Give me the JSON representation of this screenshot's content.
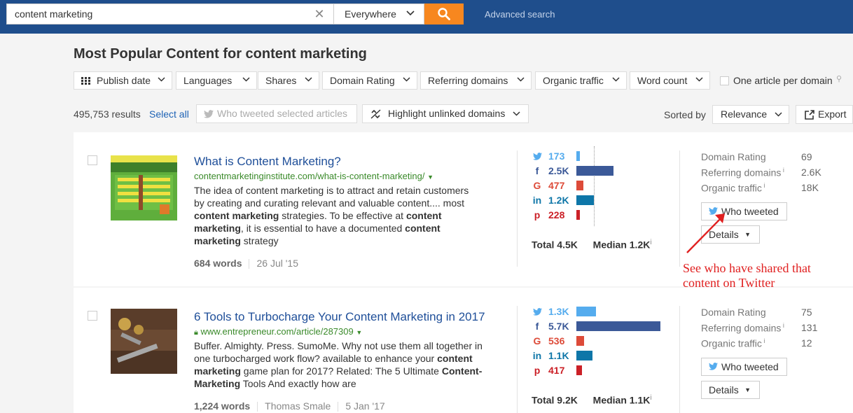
{
  "search": {
    "query": "content marketing",
    "scope": "Everywhere",
    "advanced_label": "Advanced search"
  },
  "page_title": "Most Popular Content for content marketing",
  "filters": [
    {
      "label": "Publish date"
    },
    {
      "label": "Languages"
    },
    {
      "label": "Shares"
    },
    {
      "label": "Domain Rating"
    },
    {
      "label": "Referring domains"
    },
    {
      "label": "Organic traffic"
    },
    {
      "label": "Word count"
    }
  ],
  "one_per_domain_label": "One article per domain",
  "toolbar": {
    "results_count": "495,753 results",
    "select_all": "Select all",
    "who_tweeted_selected": "Who tweeted selected articles",
    "highlight_unlinked": "Highlight unlinked domains",
    "sorted_by_label": "Sorted by",
    "sort_value": "Relevance",
    "export_label": "Export"
  },
  "results": [
    {
      "title": "What is Content Marketing?",
      "url": "contentmarketinginstitute.com/what-is-content-marketing/",
      "snippet": [
        {
          "t": "The idea of content marketing is to attract and retain customers by creating and curating relevant and valuable content.... most "
        },
        {
          "t": "content marketing",
          "b": true
        },
        {
          "t": " strategies. To be effective at "
        },
        {
          "t": "content marketing",
          "b": true
        },
        {
          "t": ", it is essential to have a documented "
        },
        {
          "t": "content marketing",
          "b": true
        },
        {
          "t": " strategy"
        }
      ],
      "words": "684 words",
      "author": "",
      "date": "26 Jul '15",
      "shares": [
        {
          "network": "twitter",
          "value": "173",
          "level": 0.04
        },
        {
          "network": "facebook",
          "value": "2.5K",
          "level": 0.44
        },
        {
          "network": "google",
          "value": "477",
          "level": 0.08
        },
        {
          "network": "linkedin",
          "value": "1.2K",
          "level": 0.21
        },
        {
          "network": "pinterest",
          "value": "228",
          "level": 0.04
        }
      ],
      "total": "Total 4.5K",
      "median": "Median 1.2K",
      "domain_rating": {
        "label": "Domain Rating",
        "value": "69"
      },
      "referring_domains": {
        "label": "Referring domains",
        "value": "2.6K"
      },
      "organic_traffic": {
        "label": "Organic traffic",
        "value": "18K"
      },
      "who_tweeted": "Who tweeted",
      "details": "Details"
    },
    {
      "title": "6 Tools to Turbocharge Your Content Marketing in 2017",
      "url": "www.entrepreneur.com/article/287309",
      "snippet": [
        {
          "t": "Buffer. Almighty. Press. SumoMe. Why not use them all together in one turbocharged work flow? available to enhance your "
        },
        {
          "t": "content marketing",
          "b": true
        },
        {
          "t": " game plan for 2017? Related:  The 5 Ultimate "
        },
        {
          "t": "Content-Marketing",
          "b": true
        },
        {
          "t": " Tools And exactly how are"
        }
      ],
      "words": "1,224 words",
      "author": "Thomas Smale",
      "date": "5 Jan '17",
      "shares": [
        {
          "network": "twitter",
          "value": "1.3K",
          "level": 0.23
        },
        {
          "network": "facebook",
          "value": "5.7K",
          "level": 1.0
        },
        {
          "network": "google",
          "value": "536",
          "level": 0.09
        },
        {
          "network": "linkedin",
          "value": "1.1K",
          "level": 0.19
        },
        {
          "network": "pinterest",
          "value": "417",
          "level": 0.07
        }
      ],
      "total": "Total 9.2K",
      "median": "Median 1.1K",
      "domain_rating": {
        "label": "Domain Rating",
        "value": "75"
      },
      "referring_domains": {
        "label": "Referring domains",
        "value": "131"
      },
      "organic_traffic": {
        "label": "Organic traffic",
        "value": "12"
      },
      "who_tweeted": "Who tweeted",
      "details": "Details"
    }
  ],
  "annotation": "See who have shared that content on Twitter",
  "colors": {
    "topbar": "#1f4e8c",
    "search_button": "#f7871f",
    "link": "#1f4f99",
    "url": "#3a8a2a",
    "twitter": "#55acee",
    "facebook": "#3b5998",
    "google": "#dd4b39",
    "linkedin": "#0e76a8",
    "pinterest": "#cb2027",
    "annotation": "#e02020"
  }
}
